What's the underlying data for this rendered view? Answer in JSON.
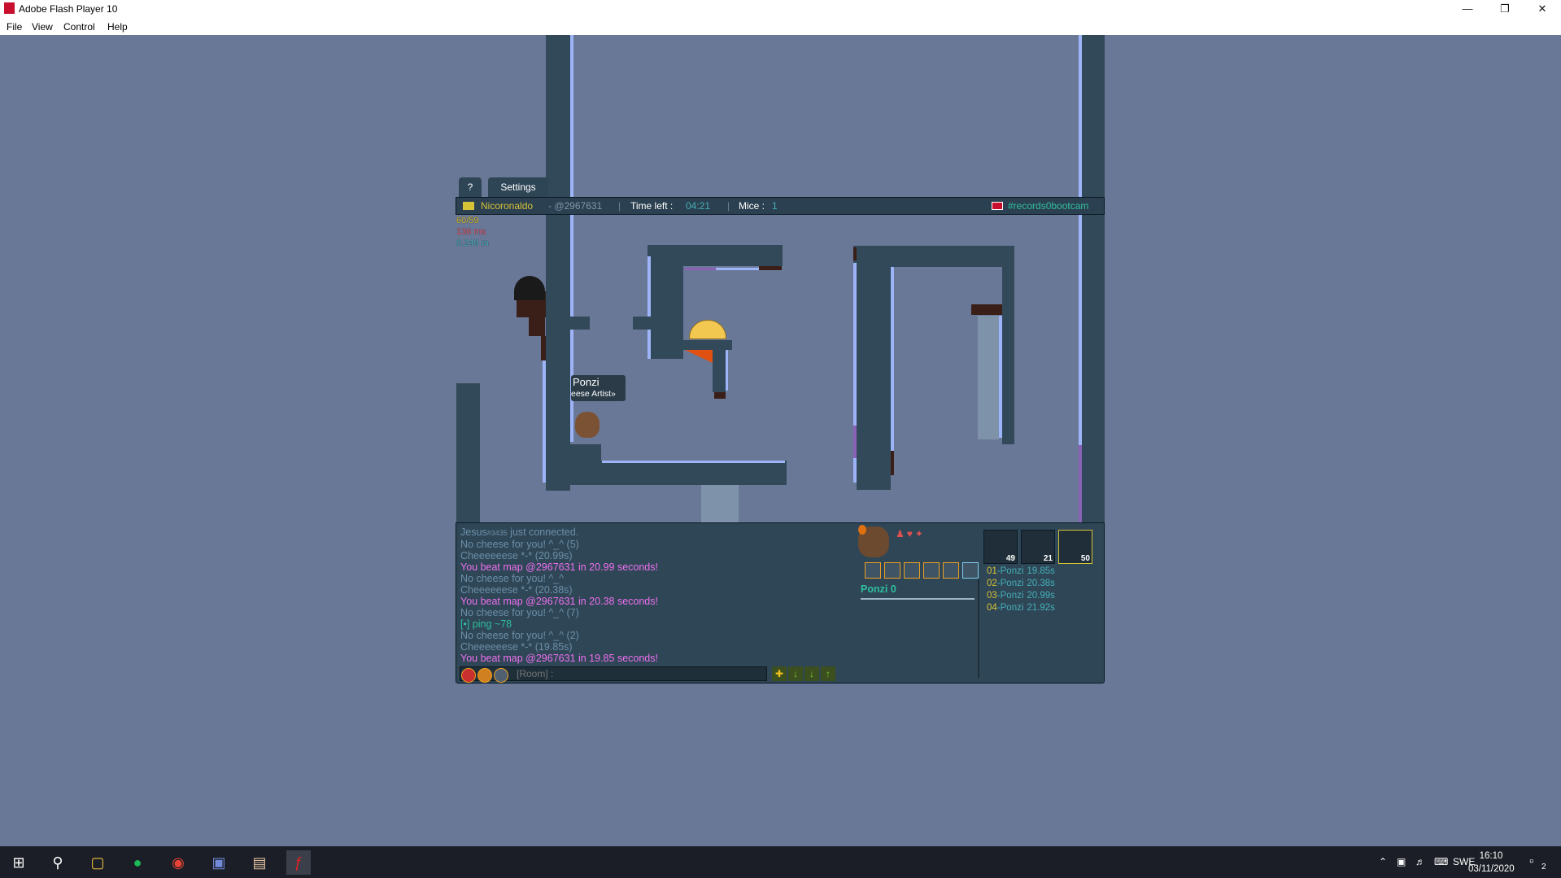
{
  "window": {
    "title": "Adobe Flash Player 10"
  },
  "menu": {
    "file": "File",
    "view": "View",
    "control": "Control",
    "help": "Help"
  },
  "game": {
    "tabs": {
      "help": "?",
      "settings": "Settings"
    },
    "topbar": {
      "author": "Nicoronaldo",
      "map_code": "- @2967631",
      "time_label": "Time left :",
      "time_value": "04:21",
      "mice_label": "Mice :",
      "mice_value": "1",
      "room": "#records0bootcam"
    },
    "stats": {
      "fps": "60/59",
      "ping": "136 ms",
      "memory": "0.249 m"
    },
    "player": {
      "name": "Ponzi",
      "title": "eese Artist»"
    },
    "chat": {
      "lines": [
        {
          "parts": [
            {
              "text": "Jesus",
              "color": "grey"
            },
            {
              "text": "#3435",
              "color": "grey_small"
            },
            {
              "text": " just connected.",
              "color": "grey"
            }
          ]
        },
        {
          "parts": [
            {
              "text": "No cheese for you! ^_^ (5)",
              "color": "grey"
            }
          ]
        },
        {
          "parts": [
            {
              "text": "Cheeeeeese *-* (20.99s)",
              "color": "grey"
            }
          ]
        },
        {
          "parts": [
            {
              "text": "You beat map @2967631 in 20.99 seconds!",
              "color": "pink"
            }
          ]
        },
        {
          "parts": [
            {
              "text": "No cheese for you! ^_^",
              "color": "grey"
            }
          ]
        },
        {
          "parts": [
            {
              "text": "Cheeeeeese *-* (20.38s)",
              "color": "grey"
            }
          ]
        },
        {
          "parts": [
            {
              "text": "You beat map @2967631 in 20.38 seconds!",
              "color": "pink"
            }
          ]
        },
        {
          "parts": [
            {
              "text": "No cheese for you! ^_^ (7)",
              "color": "grey"
            }
          ]
        },
        {
          "parts": [
            {
              "text": "[•] ping ~78",
              "color": "green"
            }
          ]
        },
        {
          "parts": [
            {
              "text": "No cheese for you! ^_^ (2)",
              "color": "grey"
            }
          ]
        },
        {
          "parts": [
            {
              "text": "Cheeeeeese *-* (19.85s)",
              "color": "grey"
            }
          ]
        },
        {
          "parts": [
            {
              "text": "You beat map @2967631 in 19.85 seconds!",
              "color": "pink"
            }
          ]
        }
      ],
      "input_placeholder": "[Room] :"
    },
    "profile": {
      "name": "Ponzi",
      "score": "0"
    },
    "badges": [
      {
        "count": "49"
      },
      {
        "count": "21"
      },
      {
        "count": "50"
      }
    ],
    "ranking": [
      {
        "rank": "01",
        "name": "-Ponzi",
        "time": "19.85s"
      },
      {
        "rank": "02",
        "name": "-Ponzi",
        "time": "20.38s"
      },
      {
        "rank": "03",
        "name": "-Ponzi",
        "time": "20.99s"
      },
      {
        "rank": "04",
        "name": "-Ponzi",
        "time": "21.92s"
      }
    ]
  },
  "taskbar": {
    "lang": "SWE",
    "time": "16:10",
    "date": "03/11/2020",
    "notifications": "2"
  },
  "colors": {
    "background": "#6a7898",
    "wall": "#324959",
    "edge": "#9db4f8",
    "pink": "#ee70f0",
    "gold": "#d6c236"
  }
}
